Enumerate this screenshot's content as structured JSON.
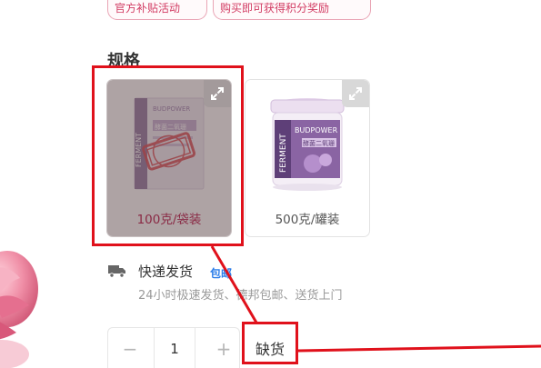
{
  "promo": {
    "tags": [
      "官方补贴活动",
      "购买即可获得积分奖励"
    ]
  },
  "spec": {
    "title": "规格",
    "options": [
      {
        "label": "100克/袋装",
        "selected": true,
        "disabled": true,
        "package": "pouch",
        "zoom_icon": "expand-icon"
      },
      {
        "label": "500克/罐装",
        "selected": false,
        "disabled": false,
        "package": "jar",
        "zoom_icon": "expand-icon"
      }
    ],
    "package_brand": "BUDPOWER",
    "package_side_text": "FERMENT",
    "package_name": "酵菌二氧珊"
  },
  "shipping": {
    "icon": "truck-icon",
    "title": "快递发货",
    "badge": "包邮",
    "description": "24小时极速发货、德邦包邮、送货上门"
  },
  "quantity": {
    "minus_label": "−",
    "value": "1",
    "plus_label": "+"
  },
  "stock_status": "缺货",
  "colors": {
    "accent_pink": "#d23c63",
    "annotation_red": "#e0111b",
    "badge_blue": "#2b7de9",
    "muted_text": "#9a9a9a"
  }
}
